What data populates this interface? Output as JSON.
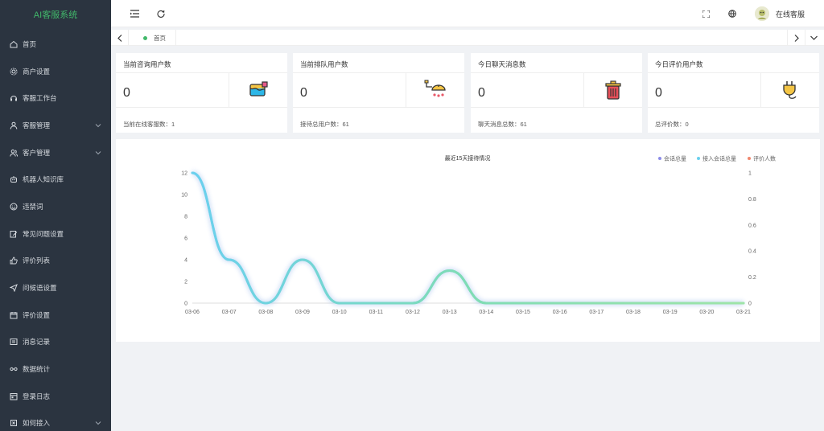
{
  "brand": "AI客服系统",
  "sidebar": {
    "items": [
      {
        "label": "首页",
        "icon": "home-icon",
        "has_children": false
      },
      {
        "label": "商户设置",
        "icon": "gear-icon",
        "has_children": false
      },
      {
        "label": "客服工作台",
        "icon": "headset-icon",
        "has_children": false
      },
      {
        "label": "客服管理",
        "icon": "user-icon",
        "has_children": true
      },
      {
        "label": "客户管理",
        "icon": "users-icon",
        "has_children": true
      },
      {
        "label": "机器人知识库",
        "icon": "robot-icon",
        "has_children": false
      },
      {
        "label": "违禁词",
        "icon": "smile-icon",
        "has_children": false
      },
      {
        "label": "常见问题设置",
        "icon": "edit-icon",
        "has_children": false
      },
      {
        "label": "评价列表",
        "icon": "thumb-icon",
        "has_children": false
      },
      {
        "label": "问候语设置",
        "icon": "send-icon",
        "has_children": false
      },
      {
        "label": "评价设置",
        "icon": "calendar-icon",
        "has_children": false
      },
      {
        "label": "消息记录",
        "icon": "message-icon",
        "has_children": false
      },
      {
        "label": "数据统计",
        "icon": "chart-icon",
        "has_children": false
      },
      {
        "label": "登录日志",
        "icon": "log-icon",
        "has_children": false
      },
      {
        "label": "如何接入",
        "icon": "plug-icon",
        "has_children": true
      }
    ]
  },
  "header": {
    "username": "在线客服"
  },
  "tabs": {
    "active_label": "首页"
  },
  "cards": [
    {
      "title": "当前咨询用户数",
      "value": "0",
      "footer": "当前在线客服数：1",
      "icon": "paint-bucket-icon"
    },
    {
      "title": "当前排队用户数",
      "value": "0",
      "footer": "接待总用户数：61",
      "icon": "shower-icon"
    },
    {
      "title": "今日聊天消息数",
      "value": "0",
      "footer": "聊天消息总数：61",
      "icon": "trash-can-icon"
    },
    {
      "title": "今日评价用户数",
      "value": "0",
      "footer": "总评价数：0",
      "icon": "plug-icon"
    }
  ],
  "colors": {
    "sidebar_bg": "#2b3440",
    "brand": "#41b86a",
    "series_total": "#8c8ce8",
    "series_received": "#6ad0ee",
    "series_rating": "#f0876e"
  },
  "chart_data": {
    "type": "line",
    "title": "最近15天接待情况",
    "categories": [
      "03-06",
      "03-07",
      "03-08",
      "03-09",
      "03-10",
      "03-11",
      "03-12",
      "03-13",
      "03-14",
      "03-15",
      "03-16",
      "03-17",
      "03-18",
      "03-19",
      "03-20",
      "03-21"
    ],
    "series": [
      {
        "name": "会话总量",
        "axis": "left",
        "values": [
          12,
          4,
          0,
          4,
          0,
          0,
          0,
          3,
          0,
          0,
          0,
          0,
          0,
          0,
          0,
          0
        ]
      },
      {
        "name": "接入会话总量",
        "axis": "left",
        "values": [
          12,
          4,
          0,
          4,
          0,
          0,
          0,
          3,
          0,
          0,
          0,
          0,
          0,
          0,
          0,
          0
        ]
      },
      {
        "name": "评价人数",
        "axis": "right",
        "values": [
          0,
          0,
          0,
          0,
          0,
          0,
          0,
          0,
          0,
          0,
          0,
          0,
          0,
          0,
          0,
          0
        ]
      }
    ],
    "y_left": {
      "ticks": [
        "0",
        "2",
        "4",
        "6",
        "8",
        "10",
        "12"
      ],
      "range": [
        0,
        12
      ]
    },
    "y_right": {
      "ticks": [
        "0",
        "0.2",
        "0.4",
        "0.6",
        "0.8",
        "1"
      ],
      "range": [
        0,
        1
      ]
    },
    "legend_position": "top-right",
    "smooth": true,
    "grid": false
  }
}
